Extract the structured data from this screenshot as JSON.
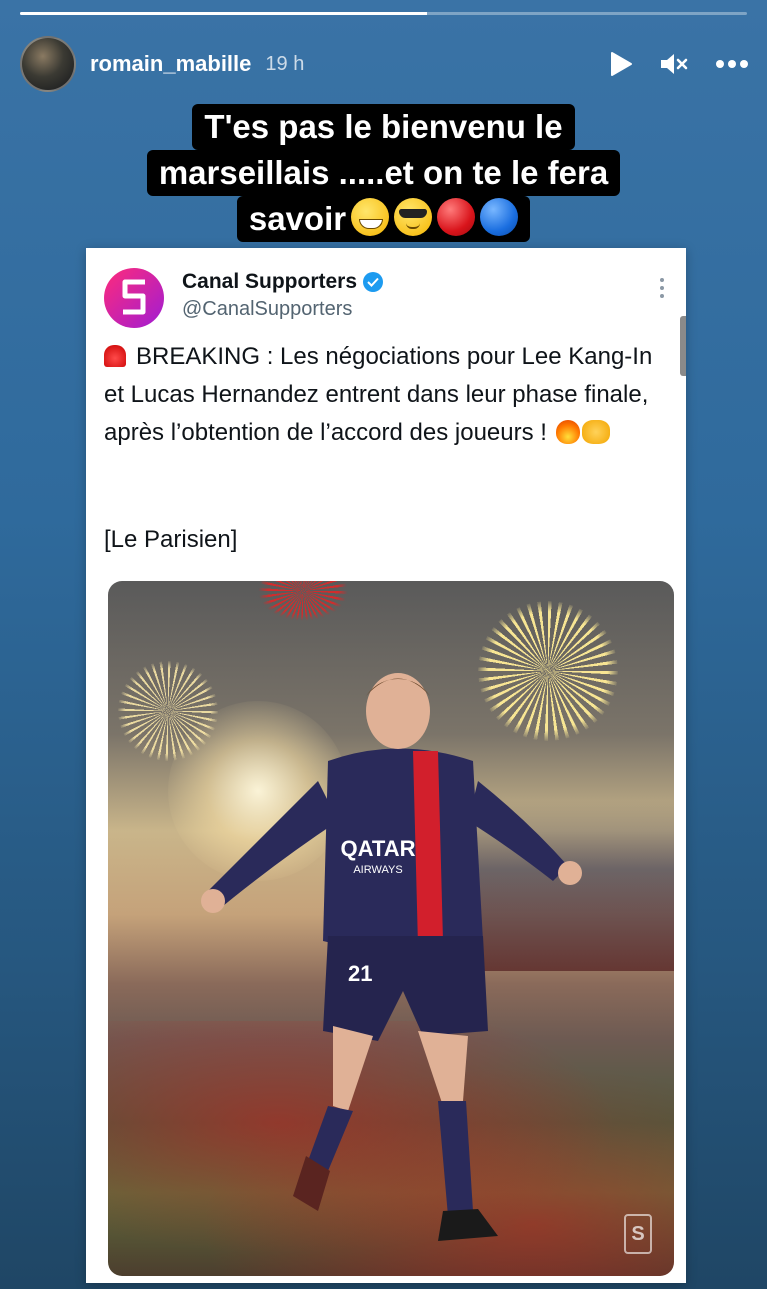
{
  "story": {
    "progress_fraction": 0.56,
    "username": "romain_mabille",
    "time_ago": "19 h",
    "controls": {
      "play_icon": "play-icon",
      "mute_icon": "muted-speaker-icon",
      "more_icon": "more-horizontal-icon"
    }
  },
  "caption": {
    "line1": "T'es pas le bienvenu le",
    "line2": "marseillais .....et on te le fera",
    "line3": "savoir",
    "emojis": [
      "grinning-face",
      "smiling-face-with-sunglasses",
      "red-circle",
      "blue-circle"
    ]
  },
  "tweet": {
    "account_name": "Canal Supporters",
    "handle": "@CanalSupporters",
    "verified": true,
    "text_breaking": "BREAKING : Les négociations pour  Lee Kang-In et Lucas Hernandez entrent dans leur phase finale, après l’obtention de l’accord des joueurs !",
    "text_emojis": [
      "police-siren-light",
      "fire",
      "handshake"
    ],
    "source": "[Le Parisien]",
    "media": {
      "shirt_sponsor": "QATAR",
      "shirt_sponsor_sub": "AIRWAYS",
      "shirt_number": "21"
    }
  },
  "colors": {
    "background_top": "#3a73a6",
    "background_bottom": "#1f4665",
    "caption_bg": "#000000",
    "verified_blue": "#1d9bf0",
    "logo_gradient_start": "#ff2b7a",
    "logo_gradient_end": "#a01cd4",
    "jersey_navy": "#2a2a5a",
    "jersey_red": "#d21f2c"
  }
}
